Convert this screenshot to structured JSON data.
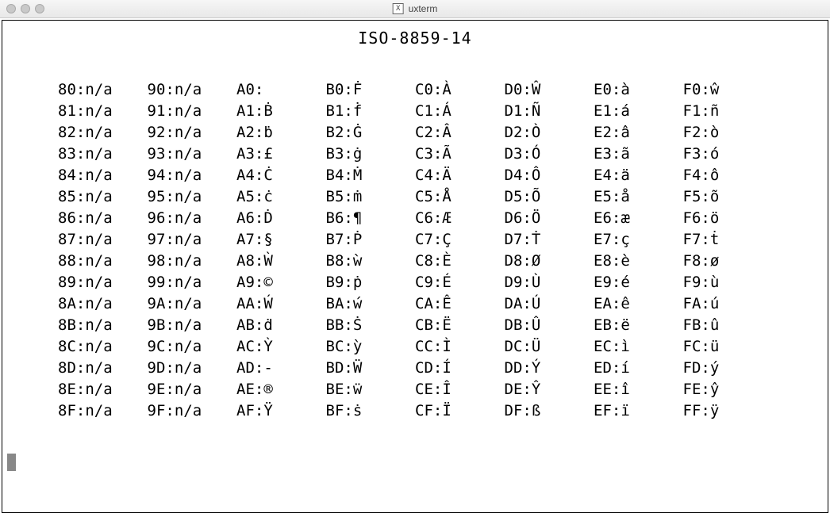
{
  "window": {
    "app_icon_label": "X",
    "title": "uxterm"
  },
  "heading": "ISO-8859-14",
  "columns": [
    [
      {
        "code": "80",
        "val": "n/a"
      },
      {
        "code": "81",
        "val": "n/a"
      },
      {
        "code": "82",
        "val": "n/a"
      },
      {
        "code": "83",
        "val": "n/a"
      },
      {
        "code": "84",
        "val": "n/a"
      },
      {
        "code": "85",
        "val": "n/a"
      },
      {
        "code": "86",
        "val": "n/a"
      },
      {
        "code": "87",
        "val": "n/a"
      },
      {
        "code": "88",
        "val": "n/a"
      },
      {
        "code": "89",
        "val": "n/a"
      },
      {
        "code": "8A",
        "val": "n/a"
      },
      {
        "code": "8B",
        "val": "n/a"
      },
      {
        "code": "8C",
        "val": "n/a"
      },
      {
        "code": "8D",
        "val": "n/a"
      },
      {
        "code": "8E",
        "val": "n/a"
      },
      {
        "code": "8F",
        "val": "n/a"
      }
    ],
    [
      {
        "code": "90",
        "val": "n/a"
      },
      {
        "code": "91",
        "val": "n/a"
      },
      {
        "code": "92",
        "val": "n/a"
      },
      {
        "code": "93",
        "val": "n/a"
      },
      {
        "code": "94",
        "val": "n/a"
      },
      {
        "code": "95",
        "val": "n/a"
      },
      {
        "code": "96",
        "val": "n/a"
      },
      {
        "code": "97",
        "val": "n/a"
      },
      {
        "code": "98",
        "val": "n/a"
      },
      {
        "code": "99",
        "val": "n/a"
      },
      {
        "code": "9A",
        "val": "n/a"
      },
      {
        "code": "9B",
        "val": "n/a"
      },
      {
        "code": "9C",
        "val": "n/a"
      },
      {
        "code": "9D",
        "val": "n/a"
      },
      {
        "code": "9E",
        "val": "n/a"
      },
      {
        "code": "9F",
        "val": "n/a"
      }
    ],
    [
      {
        "code": "A0",
        "val": " "
      },
      {
        "code": "A1",
        "val": "Ḃ"
      },
      {
        "code": "A2",
        "val": "ḃ"
      },
      {
        "code": "A3",
        "val": "£"
      },
      {
        "code": "A4",
        "val": "Ċ"
      },
      {
        "code": "A5",
        "val": "ċ"
      },
      {
        "code": "A6",
        "val": "Ḋ"
      },
      {
        "code": "A7",
        "val": "§"
      },
      {
        "code": "A8",
        "val": "Ẁ"
      },
      {
        "code": "A9",
        "val": "©"
      },
      {
        "code": "AA",
        "val": "Ẃ"
      },
      {
        "code": "AB",
        "val": "ḋ"
      },
      {
        "code": "AC",
        "val": "Ỳ"
      },
      {
        "code": "AD",
        "val": "-"
      },
      {
        "code": "AE",
        "val": "®"
      },
      {
        "code": "AF",
        "val": "Ÿ"
      }
    ],
    [
      {
        "code": "B0",
        "val": "Ḟ"
      },
      {
        "code": "B1",
        "val": "ḟ"
      },
      {
        "code": "B2",
        "val": "Ġ"
      },
      {
        "code": "B3",
        "val": "ġ"
      },
      {
        "code": "B4",
        "val": "Ṁ"
      },
      {
        "code": "B5",
        "val": "ṁ"
      },
      {
        "code": "B6",
        "val": "¶"
      },
      {
        "code": "B7",
        "val": "Ṗ"
      },
      {
        "code": "B8",
        "val": "ẁ"
      },
      {
        "code": "B9",
        "val": "ṗ"
      },
      {
        "code": "BA",
        "val": "ẃ"
      },
      {
        "code": "BB",
        "val": "Ṡ"
      },
      {
        "code": "BC",
        "val": "ỳ"
      },
      {
        "code": "BD",
        "val": "Ẅ"
      },
      {
        "code": "BE",
        "val": "ẅ"
      },
      {
        "code": "BF",
        "val": "ṡ"
      }
    ],
    [
      {
        "code": "C0",
        "val": "À"
      },
      {
        "code": "C1",
        "val": "Á"
      },
      {
        "code": "C2",
        "val": "Â"
      },
      {
        "code": "C3",
        "val": "Ã"
      },
      {
        "code": "C4",
        "val": "Ä"
      },
      {
        "code": "C5",
        "val": "Å"
      },
      {
        "code": "C6",
        "val": "Æ"
      },
      {
        "code": "C7",
        "val": "Ç"
      },
      {
        "code": "C8",
        "val": "È"
      },
      {
        "code": "C9",
        "val": "É"
      },
      {
        "code": "CA",
        "val": "Ê"
      },
      {
        "code": "CB",
        "val": "Ë"
      },
      {
        "code": "CC",
        "val": "Ì"
      },
      {
        "code": "CD",
        "val": "Í"
      },
      {
        "code": "CE",
        "val": "Î"
      },
      {
        "code": "CF",
        "val": "Ï"
      }
    ],
    [
      {
        "code": "D0",
        "val": "Ŵ"
      },
      {
        "code": "D1",
        "val": "Ñ"
      },
      {
        "code": "D2",
        "val": "Ò"
      },
      {
        "code": "D3",
        "val": "Ó"
      },
      {
        "code": "D4",
        "val": "Ô"
      },
      {
        "code": "D5",
        "val": "Õ"
      },
      {
        "code": "D6",
        "val": "Ö"
      },
      {
        "code": "D7",
        "val": "Ṫ"
      },
      {
        "code": "D8",
        "val": "Ø"
      },
      {
        "code": "D9",
        "val": "Ù"
      },
      {
        "code": "DA",
        "val": "Ú"
      },
      {
        "code": "DB",
        "val": "Û"
      },
      {
        "code": "DC",
        "val": "Ü"
      },
      {
        "code": "DD",
        "val": "Ý"
      },
      {
        "code": "DE",
        "val": "Ŷ"
      },
      {
        "code": "DF",
        "val": "ß"
      }
    ],
    [
      {
        "code": "E0",
        "val": "à"
      },
      {
        "code": "E1",
        "val": "á"
      },
      {
        "code": "E2",
        "val": "â"
      },
      {
        "code": "E3",
        "val": "ã"
      },
      {
        "code": "E4",
        "val": "ä"
      },
      {
        "code": "E5",
        "val": "å"
      },
      {
        "code": "E6",
        "val": "æ"
      },
      {
        "code": "E7",
        "val": "ç"
      },
      {
        "code": "E8",
        "val": "è"
      },
      {
        "code": "E9",
        "val": "é"
      },
      {
        "code": "EA",
        "val": "ê"
      },
      {
        "code": "EB",
        "val": "ë"
      },
      {
        "code": "EC",
        "val": "ì"
      },
      {
        "code": "ED",
        "val": "í"
      },
      {
        "code": "EE",
        "val": "î"
      },
      {
        "code": "EF",
        "val": "ï"
      }
    ],
    [
      {
        "code": "F0",
        "val": "ŵ"
      },
      {
        "code": "F1",
        "val": "ñ"
      },
      {
        "code": "F2",
        "val": "ò"
      },
      {
        "code": "F3",
        "val": "ó"
      },
      {
        "code": "F4",
        "val": "ô"
      },
      {
        "code": "F5",
        "val": "õ"
      },
      {
        "code": "F6",
        "val": "ö"
      },
      {
        "code": "F7",
        "val": "ṫ"
      },
      {
        "code": "F8",
        "val": "ø"
      },
      {
        "code": "F9",
        "val": "ù"
      },
      {
        "code": "FA",
        "val": "ú"
      },
      {
        "code": "FB",
        "val": "û"
      },
      {
        "code": "FC",
        "val": "ü"
      },
      {
        "code": "FD",
        "val": "ý"
      },
      {
        "code": "FE",
        "val": "ŷ"
      },
      {
        "code": "FF",
        "val": "ÿ"
      }
    ]
  ]
}
